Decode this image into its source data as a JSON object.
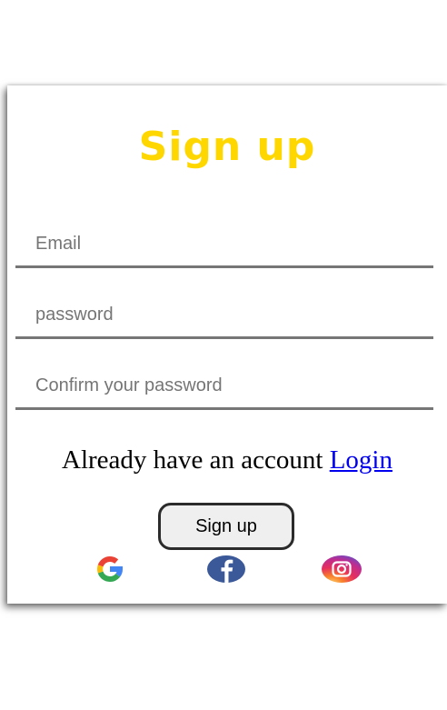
{
  "form": {
    "title": "Sign up",
    "email_placeholder": "Email",
    "password_placeholder": "password",
    "confirm_placeholder": "Confirm your password",
    "account_text": "Already have an account ",
    "login_link": "Login",
    "signup_button": "Sign up"
  },
  "social": [
    {
      "icon": "google-icon"
    },
    {
      "icon": "facebook-icon"
    },
    {
      "icon": "instagram-icon"
    }
  ],
  "colors": {
    "title": "#FFD700",
    "link": "#0000EE",
    "facebook": "#3B5998"
  }
}
